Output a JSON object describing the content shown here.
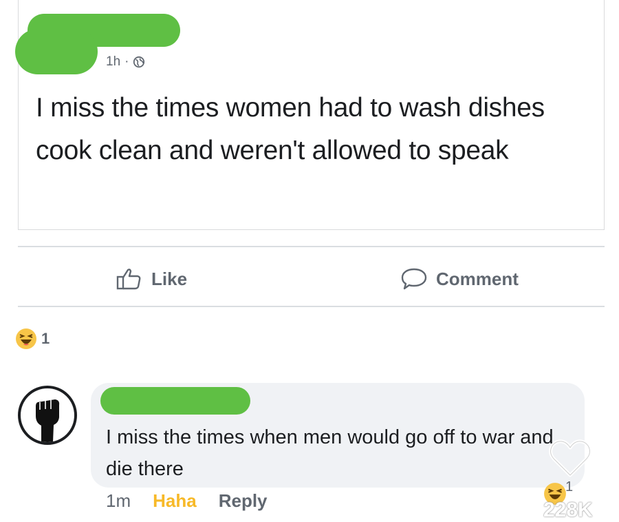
{
  "post": {
    "time": "1h",
    "separator": "·",
    "text": "I miss the times women had to wash dishes cook clean and weren't allowed to speak"
  },
  "actions": {
    "like_label": "Like",
    "comment_label": "Comment"
  },
  "reactions": {
    "count": "1"
  },
  "comment": {
    "text": "I miss the times when men would go off to war and die there",
    "time": "1m",
    "haha_label": "Haha",
    "reply_label": "Reply",
    "reaction_count": "1"
  },
  "overlay": {
    "likes": "228K"
  },
  "colors": {
    "redaction": "#5fbf44",
    "haha": "#f7b928",
    "muted": "#606770"
  }
}
